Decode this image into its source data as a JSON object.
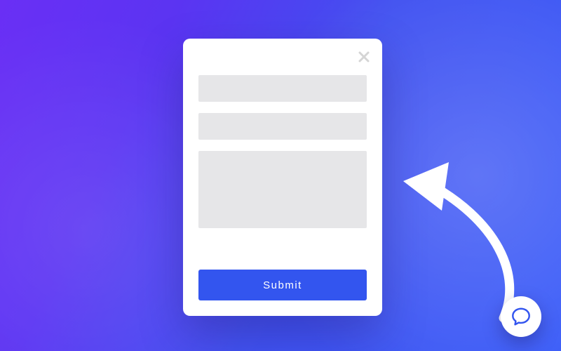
{
  "modal": {
    "close_icon": "close-icon",
    "fields": {
      "input1_placeholder": "",
      "input2_placeholder": "",
      "textarea_placeholder": ""
    },
    "submit_label": "Submit"
  },
  "chat": {
    "icon": "chat-bubble-icon"
  },
  "arrow": {
    "icon": "curved-arrow-icon"
  },
  "colors": {
    "accent": "#3355ef",
    "field": "#e6e6e8"
  }
}
